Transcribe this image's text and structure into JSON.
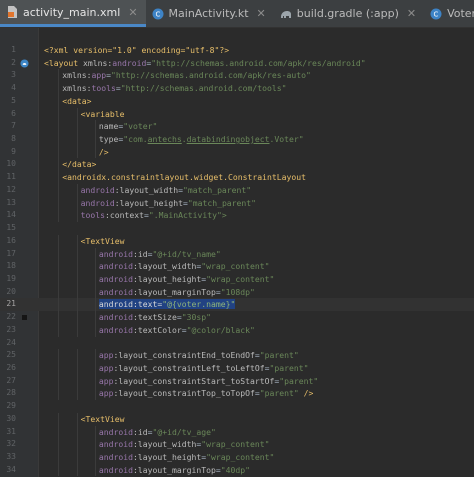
{
  "tabs": [
    {
      "label": "activity_main.xml",
      "icon": "xml-file-icon",
      "active": true
    },
    {
      "label": "MainActivity.kt",
      "icon": "kotlin-class-icon",
      "active": false
    },
    {
      "label": "build.gradle (:app)",
      "icon": "gradle-elephant-icon",
      "active": false
    },
    {
      "label": "Voter.kt",
      "icon": "kotlin-class-icon",
      "active": false
    }
  ],
  "editor": {
    "current_line": 21,
    "gutter_icons": [
      {
        "line": 2,
        "icon": "android-layout-preview-icon"
      },
      {
        "line": 22,
        "icon": "bookmark-marker"
      }
    ],
    "lines": [
      {
        "n": "1",
        "indent": 0,
        "parts": [
          [
            "pi",
            "<?xml version=\"1.0\" encoding=\"utf-8\"?>"
          ]
        ]
      },
      {
        "n": "2",
        "indent": 0,
        "parts": [
          [
            "tag",
            "<layout "
          ],
          [
            "attr",
            "xmlns:"
          ],
          [
            "ns",
            "android"
          ],
          [
            "txt",
            "="
          ],
          [
            "val",
            "\"http://schemas.android.com/apk/res/android\""
          ]
        ]
      },
      {
        "n": "3",
        "indent": 1,
        "parts": [
          [
            "attr",
            "xmlns:"
          ],
          [
            "ns",
            "app"
          ],
          [
            "txt",
            "="
          ],
          [
            "val",
            "\"http://schemas.android.com/apk/res-auto\""
          ]
        ]
      },
      {
        "n": "4",
        "indent": 1,
        "parts": [
          [
            "attr",
            "xmlns:"
          ],
          [
            "ns",
            "tools"
          ],
          [
            "txt",
            "="
          ],
          [
            "val",
            "\"http://schemas.android.com/tools\""
          ]
        ]
      },
      {
        "n": "5",
        "indent": 1,
        "parts": [
          [
            "tag",
            "<data>"
          ]
        ]
      },
      {
        "n": "6",
        "indent": 2,
        "parts": [
          [
            "tag",
            "<variable"
          ]
        ]
      },
      {
        "n": "7",
        "indent": 3,
        "parts": [
          [
            "attr",
            "name"
          ],
          [
            "txt",
            "="
          ],
          [
            "val",
            "\"voter\""
          ]
        ]
      },
      {
        "n": "8",
        "indent": 3,
        "parts": [
          [
            "attr",
            "type"
          ],
          [
            "txt",
            "="
          ],
          [
            "val",
            "\"com."
          ],
          [
            "valu",
            "antechs"
          ],
          [
            "val",
            "."
          ],
          [
            "valu",
            "databindingobject"
          ],
          [
            "val",
            ".Voter\""
          ]
        ]
      },
      {
        "n": "9",
        "indent": 3,
        "parts": [
          [
            "tag",
            "/>"
          ]
        ]
      },
      {
        "n": "10",
        "indent": 1,
        "parts": [
          [
            "tag",
            "</data>"
          ]
        ]
      },
      {
        "n": "11",
        "indent": 1,
        "parts": [
          [
            "tag",
            "<androidx.constraintlayout.widget.ConstraintLayout"
          ]
        ]
      },
      {
        "n": "12",
        "indent": 2,
        "parts": [
          [
            "ns",
            "android"
          ],
          [
            "attr",
            ":layout_width"
          ],
          [
            "txt",
            "="
          ],
          [
            "val",
            "\"match_parent\""
          ]
        ]
      },
      {
        "n": "13",
        "indent": 2,
        "parts": [
          [
            "ns",
            "android"
          ],
          [
            "attr",
            ":layout_height"
          ],
          [
            "txt",
            "="
          ],
          [
            "val",
            "\"match_parent\""
          ]
        ]
      },
      {
        "n": "14",
        "indent": 2,
        "parts": [
          [
            "ns",
            "tools"
          ],
          [
            "attr",
            ":context"
          ],
          [
            "txt",
            "="
          ],
          [
            "val",
            "\".MainActivity\">"
          ]
        ]
      },
      {
        "n": "15",
        "indent": 0,
        "parts": []
      },
      {
        "n": "16",
        "indent": 2,
        "parts": [
          [
            "tag",
            "<TextView"
          ]
        ]
      },
      {
        "n": "17",
        "indent": 3,
        "parts": [
          [
            "ns",
            "android"
          ],
          [
            "attr",
            ":id"
          ],
          [
            "txt",
            "="
          ],
          [
            "val",
            "\"@+id/tv_name\""
          ]
        ]
      },
      {
        "n": "18",
        "indent": 3,
        "parts": [
          [
            "ns",
            "android"
          ],
          [
            "attr",
            ":layout_width"
          ],
          [
            "txt",
            "="
          ],
          [
            "val",
            "\"wrap_content\""
          ]
        ]
      },
      {
        "n": "19",
        "indent": 3,
        "parts": [
          [
            "ns",
            "android"
          ],
          [
            "attr",
            ":layout_height"
          ],
          [
            "txt",
            "="
          ],
          [
            "val",
            "\"wrap_content\""
          ]
        ]
      },
      {
        "n": "20",
        "indent": 3,
        "parts": [
          [
            "ns",
            "android"
          ],
          [
            "attr",
            ":layout_marginTop"
          ],
          [
            "txt",
            "="
          ],
          [
            "val",
            "\"108dp\""
          ]
        ]
      },
      {
        "n": "21",
        "indent": 3,
        "parts": [
          [
            "sel",
            "android:text="
          ],
          [
            "selv",
            "\"@{voter.name}\""
          ]
        ]
      },
      {
        "n": "22",
        "indent": 3,
        "parts": [
          [
            "ns",
            "android"
          ],
          [
            "attr",
            ":textSize"
          ],
          [
            "txt",
            "="
          ],
          [
            "val",
            "\"30sp\""
          ]
        ]
      },
      {
        "n": "23",
        "indent": 3,
        "parts": [
          [
            "ns",
            "android"
          ],
          [
            "attr",
            ":textColor"
          ],
          [
            "txt",
            "="
          ],
          [
            "val",
            "\"@color/black\""
          ]
        ]
      },
      {
        "n": "24",
        "indent": 0,
        "parts": []
      },
      {
        "n": "25",
        "indent": 3,
        "parts": [
          [
            "ns",
            "app"
          ],
          [
            "attr",
            ":layout_constraintEnd_toEndOf"
          ],
          [
            "txt",
            "="
          ],
          [
            "val",
            "\"parent\""
          ]
        ]
      },
      {
        "n": "26",
        "indent": 3,
        "parts": [
          [
            "ns",
            "app"
          ],
          [
            "attr",
            ":layout_constraintLeft_toLeftOf"
          ],
          [
            "txt",
            "="
          ],
          [
            "val",
            "\"parent\""
          ]
        ]
      },
      {
        "n": "27",
        "indent": 3,
        "parts": [
          [
            "ns",
            "app"
          ],
          [
            "attr",
            ":layout_constraintStart_toStartOf"
          ],
          [
            "txt",
            "="
          ],
          [
            "val",
            "\"parent\""
          ]
        ]
      },
      {
        "n": "28",
        "indent": 3,
        "parts": [
          [
            "ns",
            "app"
          ],
          [
            "attr",
            ":layout_constraintTop_toTopOf"
          ],
          [
            "txt",
            "="
          ],
          [
            "val",
            "\"parent\""
          ],
          [
            "tag",
            " />"
          ]
        ]
      },
      {
        "n": "29",
        "indent": 0,
        "parts": []
      },
      {
        "n": "30",
        "indent": 2,
        "parts": [
          [
            "tag",
            "<TextView"
          ]
        ]
      },
      {
        "n": "31",
        "indent": 3,
        "parts": [
          [
            "ns",
            "android"
          ],
          [
            "attr",
            ":id"
          ],
          [
            "txt",
            "="
          ],
          [
            "val",
            "\"@+id/tv_age\""
          ]
        ]
      },
      {
        "n": "32",
        "indent": 3,
        "parts": [
          [
            "ns",
            "android"
          ],
          [
            "attr",
            ":layout_width"
          ],
          [
            "txt",
            "="
          ],
          [
            "val",
            "\"wrap_content\""
          ]
        ]
      },
      {
        "n": "33",
        "indent": 3,
        "parts": [
          [
            "ns",
            "android"
          ],
          [
            "attr",
            ":layout_height"
          ],
          [
            "txt",
            "="
          ],
          [
            "val",
            "\"wrap_content\""
          ]
        ]
      },
      {
        "n": "34",
        "indent": 3,
        "parts": [
          [
            "ns",
            "android"
          ],
          [
            "attr",
            ":layout_marginTop"
          ],
          [
            "txt",
            "="
          ],
          [
            "val",
            "\"40dp\""
          ]
        ]
      }
    ]
  },
  "colors": {
    "background": "#2b2b2b",
    "tag": "#e8bf6a",
    "attribute": "#bababa",
    "namespace": "#9876aa",
    "string_value": "#6a8759",
    "selection": "#214283",
    "active_tab_underline": "#4a88c7"
  }
}
